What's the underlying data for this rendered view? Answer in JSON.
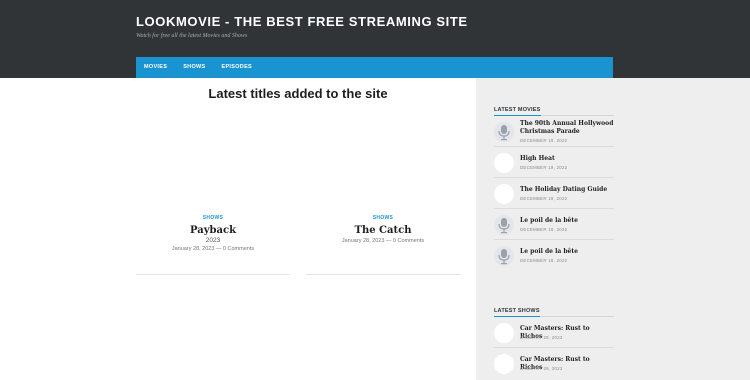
{
  "site": {
    "title": "LOOKMOVIE - THE BEST FREE STREAMING SITE",
    "tagline": "Watch for free all the latest Movies and Shows"
  },
  "nav": {
    "items": [
      {
        "label": "MOVIES"
      },
      {
        "label": "SHOWS"
      },
      {
        "label": "EPISODES"
      }
    ]
  },
  "main": {
    "heading": "Latest titles added to the site",
    "posts": [
      {
        "category": "SHOWS",
        "title": "Payback",
        "year": "2023",
        "meta": "January 28, 2023 — 0 Comments"
      },
      {
        "category": "SHOWS",
        "title": "The Catch",
        "year": "",
        "meta": "January 28, 2023 — 0 Comments"
      }
    ]
  },
  "sidebar": {
    "movies": {
      "title": "LATEST MOVIES",
      "items": [
        {
          "title": "The 90th Annual Hollywood Christmas Parade",
          "date": "DECEMBER 19, 2022",
          "thumb": "mic-icon"
        },
        {
          "title": "High Heat",
          "date": "DECEMBER 19, 2022",
          "thumb": "blank"
        },
        {
          "title": "The Holiday Dating Guide",
          "date": "DECEMBER 19, 2022",
          "thumb": "blank"
        },
        {
          "title": "Le poil de la bête",
          "date": "DECEMBER 19, 2022",
          "thumb": "mic-icon"
        },
        {
          "title": "Le poil de la bête",
          "date": "DECEMBER 18, 2022",
          "thumb": "mic-icon"
        }
      ]
    },
    "shows": {
      "title": "LATEST SHOWS",
      "items": [
        {
          "title": "Car Masters: Rust to Riches",
          "date": "JANUARY 29, 2023",
          "thumb": "blank"
        },
        {
          "title": "Car Masters: Rust to Riches",
          "date": "JANUARY 29, 2023",
          "thumb": "blank"
        }
      ]
    }
  },
  "colors": {
    "header_bg": "#303437",
    "nav_bg": "#1a94d0",
    "accent": "#1a94d0",
    "sidebar_bg": "#eeeeee"
  }
}
